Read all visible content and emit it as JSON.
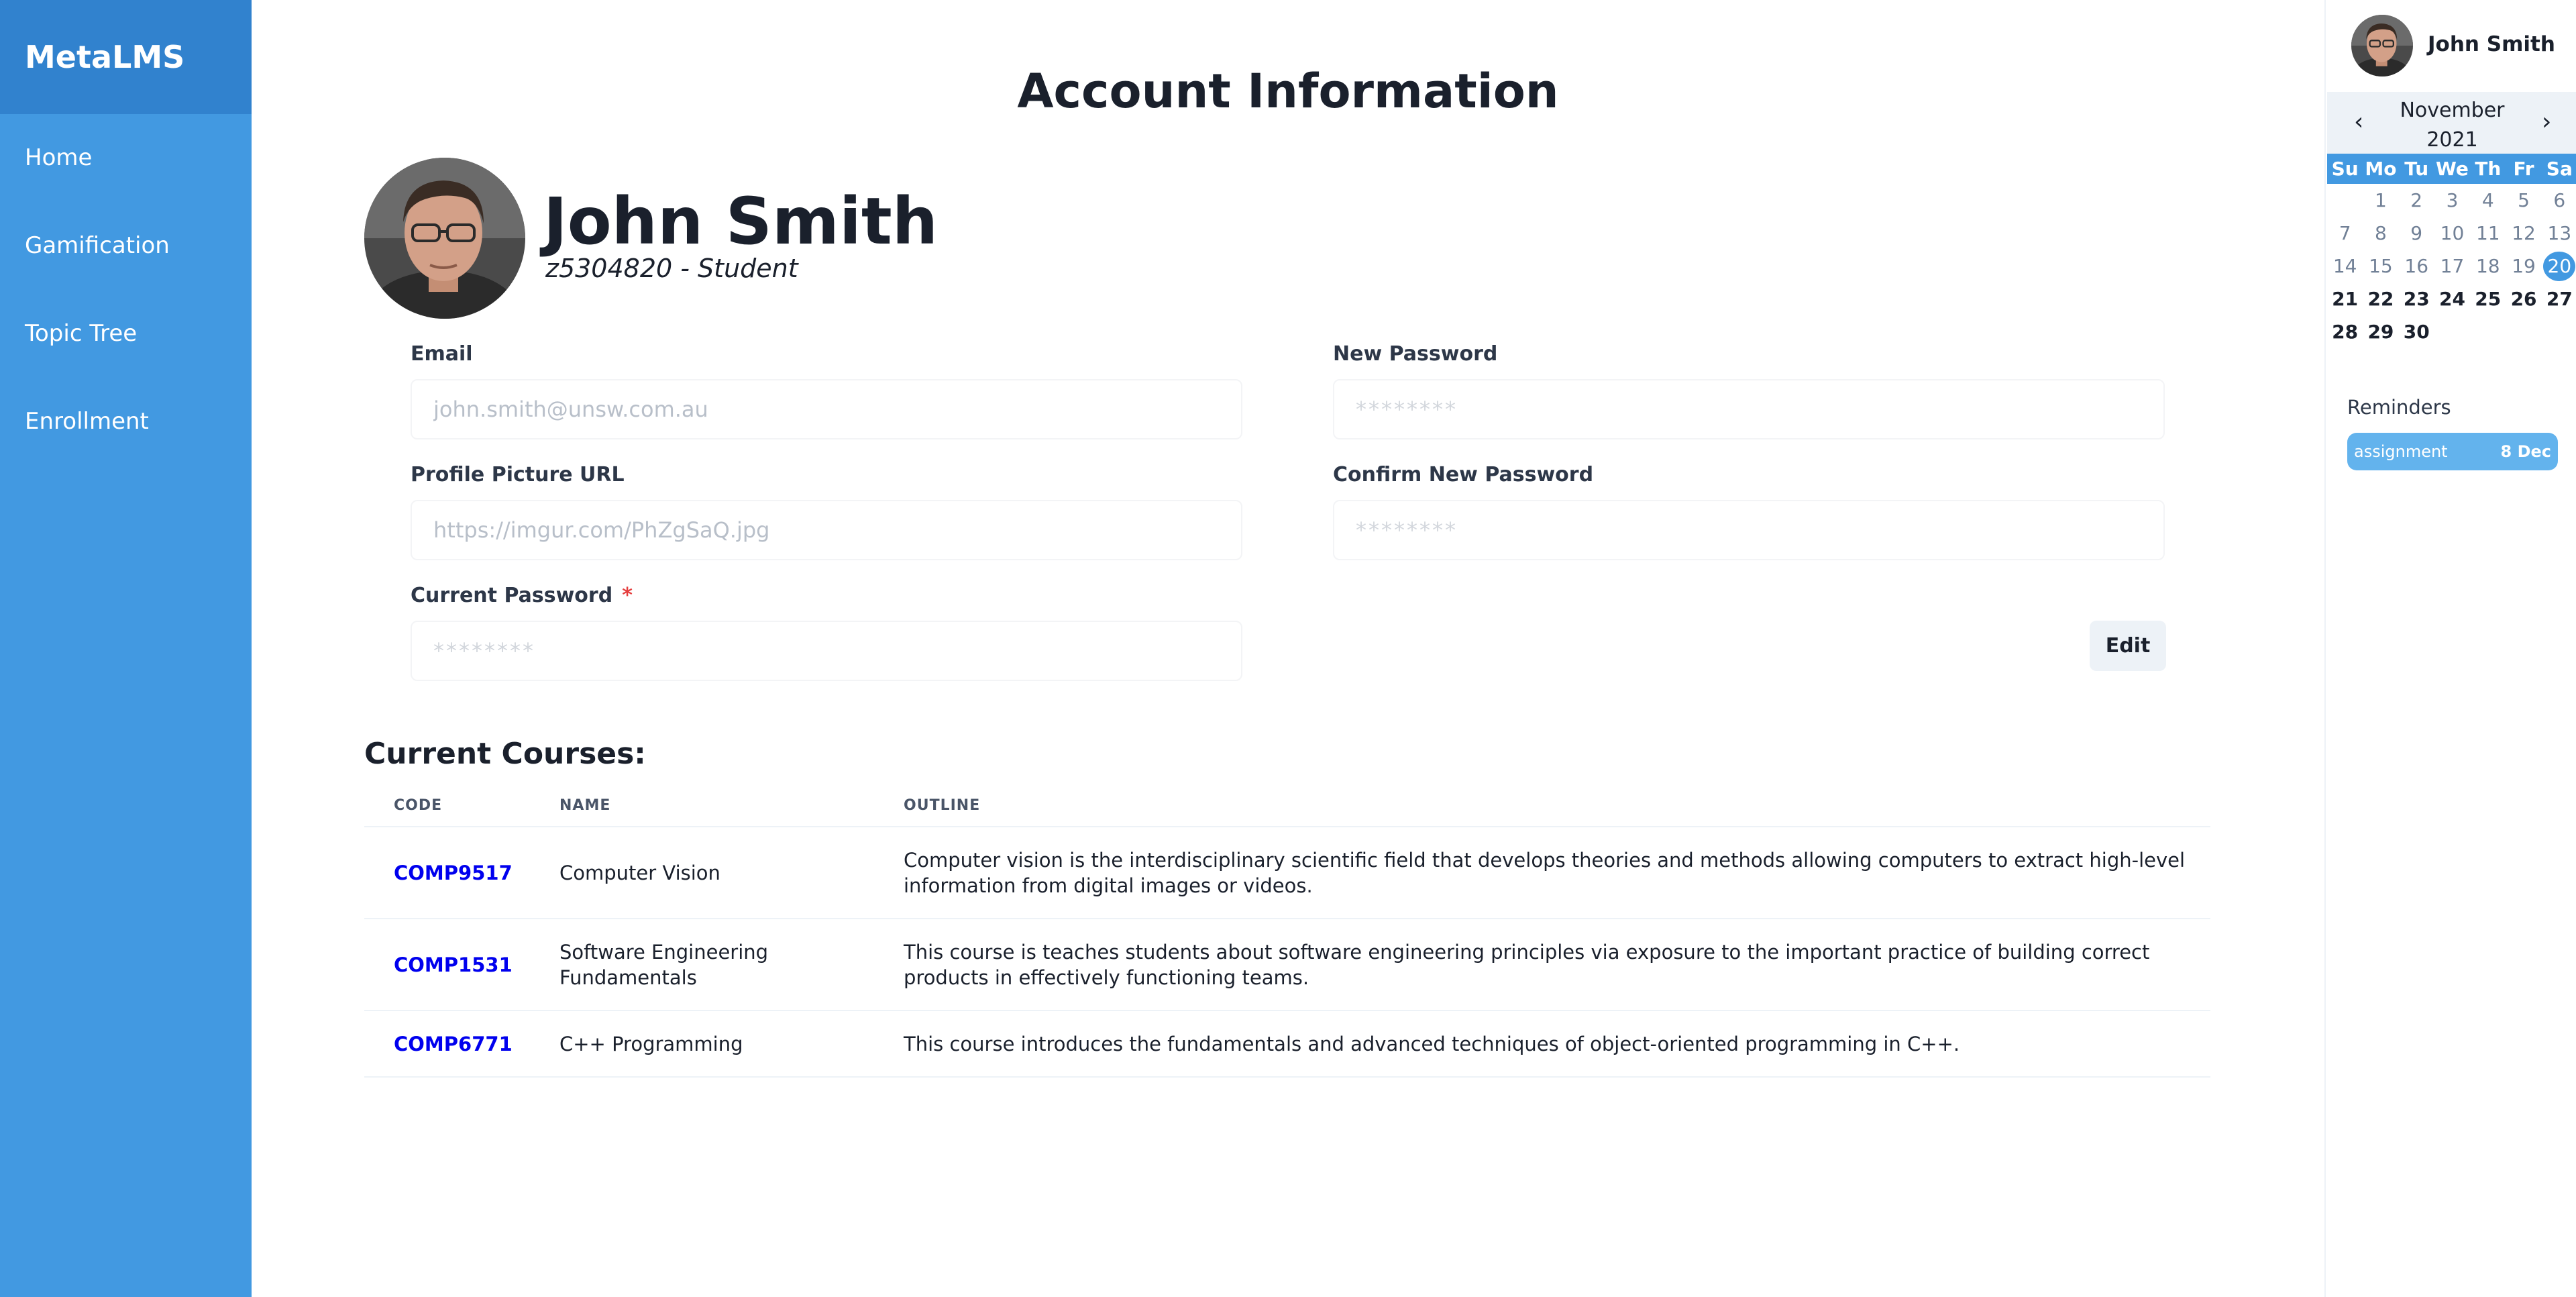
{
  "app": {
    "brand": "MetaLMS"
  },
  "sidebar": {
    "items": [
      {
        "label": "Home"
      },
      {
        "label": "Gamification"
      },
      {
        "label": "Topic Tree"
      },
      {
        "label": "Enrollment"
      }
    ]
  },
  "page": {
    "title": "Account Information"
  },
  "profile": {
    "name": "John Smith",
    "subtitle": "z5304820 - Student"
  },
  "form": {
    "email": {
      "label": "Email",
      "placeholder": "john.smith@unsw.com.au"
    },
    "new_password": {
      "label": "New Password",
      "placeholder": "********"
    },
    "profile_picture": {
      "label": "Profile Picture URL",
      "placeholder": "https://imgur.com/PhZgSaQ.jpg"
    },
    "confirm_password": {
      "label": "Confirm New Password",
      "placeholder": "********"
    },
    "current_password": {
      "label": "Current Password",
      "required_mark": "*",
      "placeholder": "********"
    },
    "edit_label": "Edit"
  },
  "courses": {
    "heading": "Current Courses:",
    "columns": [
      "CODE",
      "NAME",
      "OUTLINE"
    ],
    "rows": [
      {
        "code": "COMP9517",
        "name": "Computer Vision",
        "outline": "Computer vision is the interdisciplinary scientific field that develops theories and methods allowing computers to extract high-level information from digital images or videos."
      },
      {
        "code": "COMP1531",
        "name": "Software Engineering Fundamentals",
        "outline": "This course is teaches students about software engineering principles via exposure to the important practice of building correct products in effectively functioning teams."
      },
      {
        "code": "COMP6771",
        "name": "C++ Programming",
        "outline": "This course introduces the fundamentals and advanced techniques of object-oriented programming in C++."
      }
    ]
  },
  "user": {
    "name": "John Smith"
  },
  "calendar": {
    "month": "November",
    "year": "2021",
    "prev": "‹",
    "next": "›",
    "weekdays": [
      "Su",
      "Mo",
      "Tu",
      "We",
      "Th",
      "Fr",
      "Sa"
    ],
    "first_weekday_index": 1,
    "days_in_month": 30,
    "today": 20,
    "accent": "#4299e1"
  },
  "reminders": {
    "title": "Reminders",
    "items": [
      {
        "text": "assignment",
        "date": "8 Dec"
      }
    ]
  },
  "colors": {
    "sidebar": "#4299e1",
    "brand_bar": "#3182ce",
    "link": "#0000ee",
    "reminder": "#63b3ed"
  }
}
